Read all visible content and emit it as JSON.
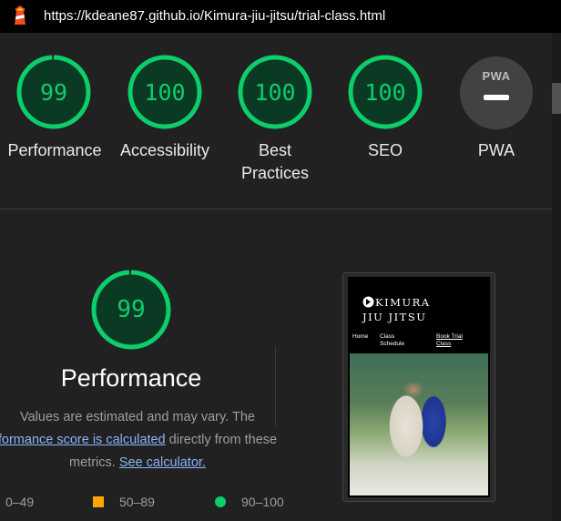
{
  "url_bar": {
    "url": "https://kdeane87.github.io/Kimura-jiu-jitsu/trial-class.html",
    "logo_icon": "lighthouse-icon"
  },
  "colors": {
    "pass": "#0cce6b",
    "average": "#ffa400",
    "fail": "#ff4e42",
    "link": "#8ab4f8",
    "background": "#212121"
  },
  "gauges": [
    {
      "score": "99",
      "label": "Performance",
      "fraction": 0.99
    },
    {
      "score": "100",
      "label": "Accessibility",
      "fraction": 1.0
    },
    {
      "score": "100",
      "label_line1": "Best",
      "label_line2": "Practices",
      "fraction": 1.0
    },
    {
      "score": "100",
      "label": "SEO",
      "fraction": 1.0
    }
  ],
  "pwa": {
    "badge": "PWA",
    "label": "PWA"
  },
  "performance": {
    "score": "99",
    "fraction": 0.99,
    "title": "Performance",
    "desc_part1": "Values are estimated and may vary. The",
    "desc_link1": "formance score is calculated",
    "desc_part2": " directly from these",
    "desc_part3": "metrics. ",
    "desc_link2": "See calculator."
  },
  "legend": {
    "fail": "0–49",
    "average": "50–89",
    "pass": "90–100"
  },
  "thumbnail": {
    "brand_line1": "KIMURA",
    "brand_line2": "JIU JITSU",
    "nav_home": "Home",
    "nav_class_line1": "Class",
    "nav_class_line2": "Schedule",
    "nav_book_line1": "Book Trial",
    "nav_book_line2": "Class"
  }
}
